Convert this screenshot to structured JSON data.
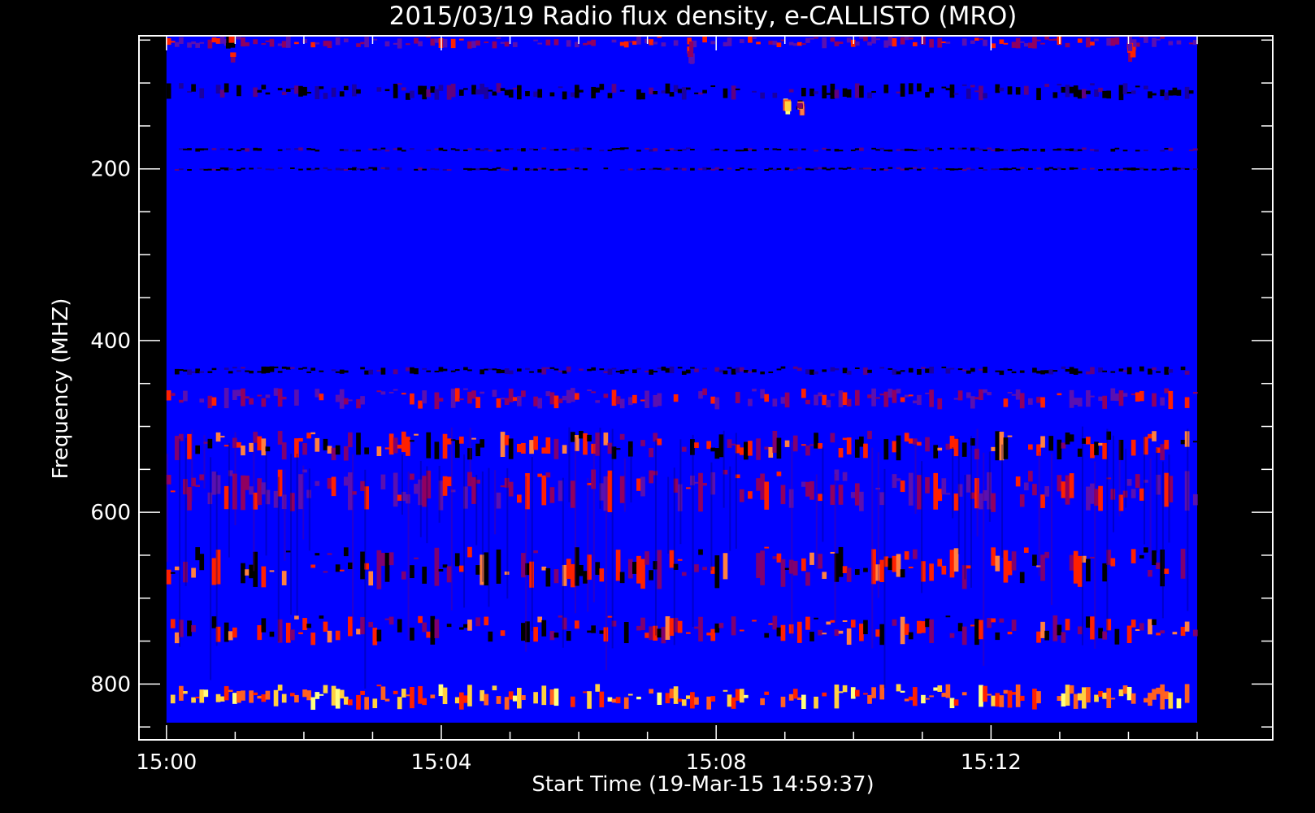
{
  "chart_data": {
    "type": "heatmap",
    "title": "2015/03/19  Radio flux density, e-CALLISTO (MRO)",
    "xlabel": "Start Time (19-Mar-15 14:59:37)",
    "ylabel": "Frequency (MHZ)",
    "x_start_time": "15:00",
    "x_end_time": "15:15",
    "xlim_minutes": [
      -0.4,
      16.1
    ],
    "ylim_mhz": [
      865,
      45
    ],
    "y_inverted": true,
    "x_ticks": [
      {
        "label": "15:00",
        "value": 0
      },
      {
        "label": "15:04",
        "value": 4
      },
      {
        "label": "15:08",
        "value": 8
      },
      {
        "label": "15:12",
        "value": 12
      }
    ],
    "y_ticks": [
      {
        "label": "200",
        "value": 200
      },
      {
        "label": "400",
        "value": 400
      },
      {
        "label": "600",
        "value": 600
      },
      {
        "label": "800",
        "value": 800
      }
    ],
    "x_minor_step_minutes": 1,
    "y_minor_step_mhz": 50,
    "data_extent": {
      "x_minutes": [
        0,
        15
      ],
      "freq_mhz": [
        45,
        845
      ]
    },
    "colormap": [
      "#000000",
      "#0000ff",
      "#ff2000",
      "#ffff80"
    ],
    "background_color": "#0000ff",
    "emission_bands_mhz": [
      {
        "range": [
          45,
          60
        ],
        "level": "medium"
      },
      {
        "range": [
          100,
          120
        ],
        "level": "dark"
      },
      {
        "range": [
          175,
          180
        ],
        "level": "dark"
      },
      {
        "range": [
          198,
          202
        ],
        "level": "dark"
      },
      {
        "range": [
          430,
          440
        ],
        "level": "dark"
      },
      {
        "range": [
          455,
          480
        ],
        "level": "medium"
      },
      {
        "range": [
          505,
          540
        ],
        "level": "high"
      },
      {
        "range": [
          550,
          600
        ],
        "level": "medium"
      },
      {
        "range": [
          640,
          690
        ],
        "level": "high"
      },
      {
        "range": [
          720,
          755
        ],
        "level": "high"
      },
      {
        "range": [
          800,
          830
        ],
        "level": "very_high"
      }
    ],
    "bursts": [
      {
        "time_minutes": 0.9,
        "freq_mhz": [
          45,
          80
        ],
        "level": "high"
      },
      {
        "time_minutes": 9.0,
        "freq_mhz": [
          118,
          130
        ],
        "level": "very_high"
      },
      {
        "time_minutes": 9.2,
        "freq_mhz": [
          118,
          130
        ],
        "level": "high"
      },
      {
        "time_minutes": 7.6,
        "freq_mhz": [
          45,
          80
        ],
        "level": "medium"
      },
      {
        "time_minutes": 14.0,
        "freq_mhz": [
          45,
          75
        ],
        "level": "medium"
      }
    ]
  }
}
